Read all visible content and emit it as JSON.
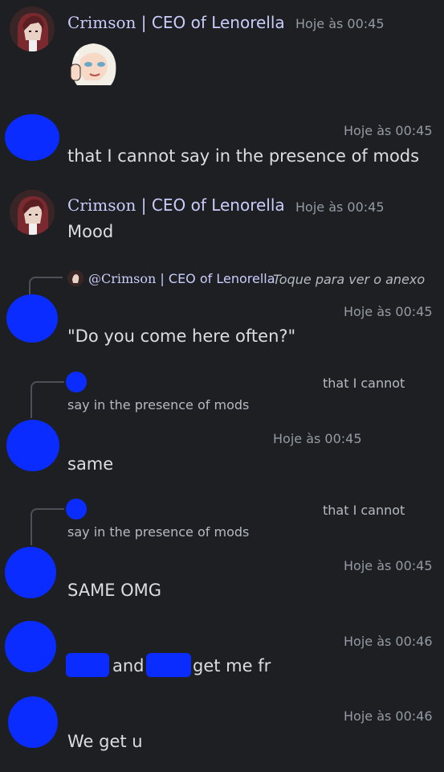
{
  "messages": [
    {
      "author_serif": "Crimson",
      "author_sep": " | ",
      "author_rest": "CEO of Lenorella",
      "time": "Hoje às 00:45",
      "sticker": "anime-girl-sticker"
    },
    {
      "time": "Hoje às 00:45",
      "text": "that I cannot say in the presence of mods"
    },
    {
      "author_serif": "Crimson",
      "author_sep": " | ",
      "author_rest": "CEO of Lenorella",
      "time": "Hoje às 00:45",
      "text": "Mood"
    },
    {
      "reply_name_serif": "@Crimson",
      "reply_name_rest": " | CEO of Lenorella",
      "reply_text": "Toque para ver o anexo",
      "time": "Hoje às 00:45",
      "text": "\"Do you come here often?\""
    },
    {
      "reply_text_a": "that I cannot",
      "reply_text_b": "say in the presence of mods",
      "time": "Hoje às 00:45",
      "text": "same"
    },
    {
      "reply_text_a": "that I cannot",
      "reply_text_b": "say in the presence of mods",
      "time": "Hoje às 00:45",
      "text": "SAME OMG"
    },
    {
      "time": "Hoje às 00:46",
      "text_a": "and",
      "text_b": "get me fr"
    },
    {
      "time": "Hoje às 00:46",
      "text": "We get u"
    }
  ]
}
